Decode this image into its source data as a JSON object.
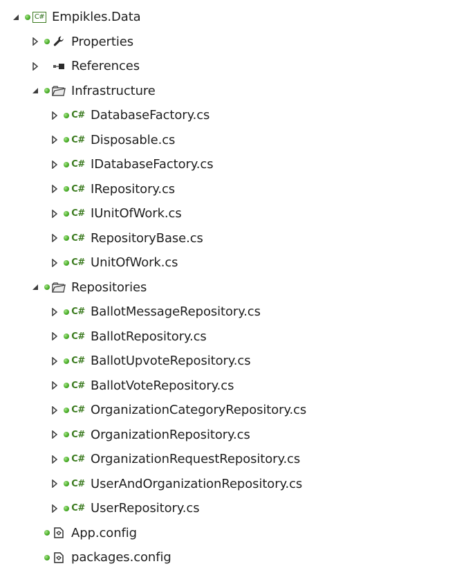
{
  "solution_explorer": {
    "project": {
      "label": "Empikles.Data",
      "icon": "csharp-project-icon",
      "expanded": true
    },
    "items": [
      {
        "label": "Properties",
        "icon": "wrench-icon",
        "depth": 1,
        "expander": "collapsed",
        "status": "green-dot"
      },
      {
        "label": "References",
        "icon": "references-icon",
        "depth": 1,
        "expander": "collapsed",
        "status": "none"
      },
      {
        "label": "Infrastructure",
        "icon": "folder-icon",
        "depth": 1,
        "expander": "expanded",
        "status": "green-dot"
      },
      {
        "label": "DatabaseFactory.cs",
        "icon": "csharp-file-icon",
        "depth": 2,
        "expander": "collapsed",
        "status": "green-dot"
      },
      {
        "label": "Disposable.cs",
        "icon": "csharp-file-icon",
        "depth": 2,
        "expander": "collapsed",
        "status": "green-dot"
      },
      {
        "label": "IDatabaseFactory.cs",
        "icon": "csharp-file-icon",
        "depth": 2,
        "expander": "collapsed",
        "status": "green-dot"
      },
      {
        "label": "IRepository.cs",
        "icon": "csharp-file-icon",
        "depth": 2,
        "expander": "collapsed",
        "status": "green-dot"
      },
      {
        "label": "IUnitOfWork.cs",
        "icon": "csharp-file-icon",
        "depth": 2,
        "expander": "collapsed",
        "status": "green-dot"
      },
      {
        "label": "RepositoryBase.cs",
        "icon": "csharp-file-icon",
        "depth": 2,
        "expander": "collapsed",
        "status": "green-dot"
      },
      {
        "label": "UnitOfWork.cs",
        "icon": "csharp-file-icon",
        "depth": 2,
        "expander": "collapsed",
        "status": "green-dot"
      },
      {
        "label": "Repositories",
        "icon": "folder-icon",
        "depth": 1,
        "expander": "expanded",
        "status": "green-dot"
      },
      {
        "label": "BallotMessageRepository.cs",
        "icon": "csharp-file-icon",
        "depth": 2,
        "expander": "collapsed",
        "status": "green-dot"
      },
      {
        "label": "BallotRepository.cs",
        "icon": "csharp-file-icon",
        "depth": 2,
        "expander": "collapsed",
        "status": "green-dot"
      },
      {
        "label": "BallotUpvoteRepository.cs",
        "icon": "csharp-file-icon",
        "depth": 2,
        "expander": "collapsed",
        "status": "green-dot"
      },
      {
        "label": "BallotVoteRepository.cs",
        "icon": "csharp-file-icon",
        "depth": 2,
        "expander": "collapsed",
        "status": "green-dot"
      },
      {
        "label": "OrganizationCategoryRepository.cs",
        "icon": "csharp-file-icon",
        "depth": 2,
        "expander": "collapsed",
        "status": "green-dot"
      },
      {
        "label": "OrganizationRepository.cs",
        "icon": "csharp-file-icon",
        "depth": 2,
        "expander": "collapsed",
        "status": "green-dot"
      },
      {
        "label": "OrganizationRequestRepository.cs",
        "icon": "csharp-file-icon",
        "depth": 2,
        "expander": "collapsed",
        "status": "green-dot"
      },
      {
        "label": "UserAndOrganizationRepository.cs",
        "icon": "csharp-file-icon",
        "depth": 2,
        "expander": "collapsed",
        "status": "green-dot"
      },
      {
        "label": "UserRepository.cs",
        "icon": "csharp-file-icon",
        "depth": 2,
        "expander": "collapsed",
        "status": "green-dot"
      },
      {
        "label": "App.config",
        "icon": "config-file-icon",
        "depth": 1,
        "expander": "none",
        "status": "green-dot"
      },
      {
        "label": "packages.config",
        "icon": "config-file-icon",
        "depth": 1,
        "expander": "none",
        "status": "green-dot"
      }
    ],
    "colors": {
      "status_green": "#4caf2a",
      "csharp_green": "#3a7a1e",
      "folder_gray": "#5a5a5a",
      "text": "#1e1e1e"
    },
    "glyphs": {
      "csharp_file": "C#",
      "csharp_project": "C#"
    }
  }
}
